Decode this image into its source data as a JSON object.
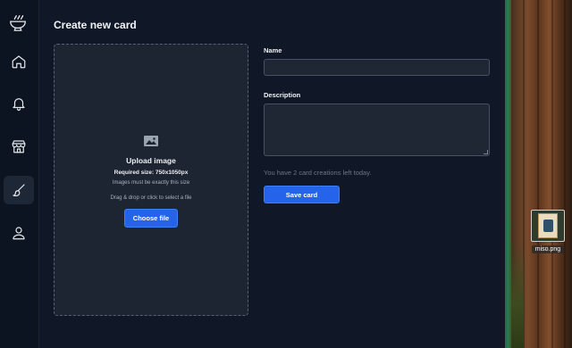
{
  "sidebar": {
    "logo_icon": "noodle-bowl-icon",
    "items": [
      {
        "icon": "home-icon",
        "active": false
      },
      {
        "icon": "bell-icon",
        "active": false
      },
      {
        "icon": "store-icon",
        "active": false
      },
      {
        "icon": "paintbrush-icon",
        "active": true
      },
      {
        "icon": "user-icon",
        "active": false
      }
    ]
  },
  "page": {
    "title": "Create new card"
  },
  "upload": {
    "icon": "image-icon",
    "title": "Upload image",
    "required": "Required size: 750x1050px",
    "exact": "Images must be exactly this size",
    "drag": "Drag & drop or click to select a file",
    "button": "Choose file"
  },
  "form": {
    "name_label": "Name",
    "name_value": "",
    "description_label": "Description",
    "description_value": "",
    "remaining_note": "You have 2 card creations left today.",
    "save_label": "Save card"
  },
  "desktop": {
    "file_name": "miso.png"
  },
  "colors": {
    "accent": "#2563eb",
    "background": "#101827",
    "panel": "#1d2432"
  }
}
